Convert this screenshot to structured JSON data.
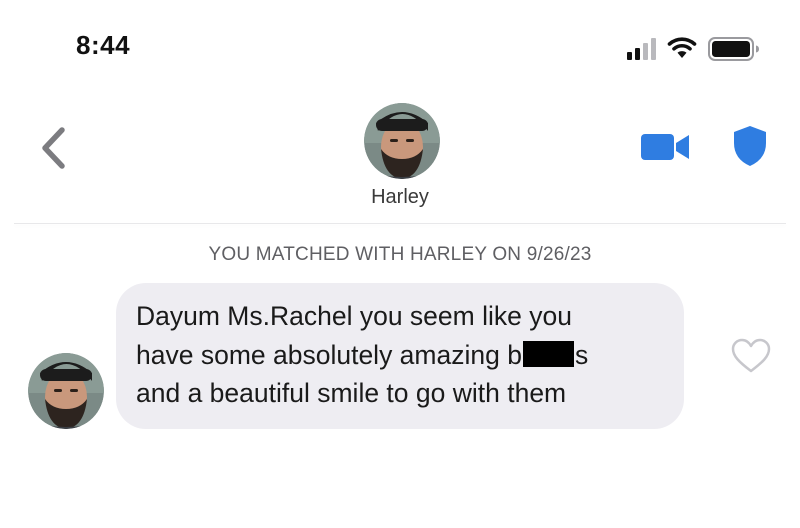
{
  "status_bar": {
    "time": "8:44"
  },
  "header": {
    "contact_name": "Harley"
  },
  "conversation": {
    "match_notice": "YOU MATCHED WITH HARLEY ON 9/26/23",
    "message": {
      "line1": "Dayum Ms.Rachel you seem like you",
      "line2_start": "have some absolutely amazing b",
      "line2_end": "s",
      "line3": "and a beautiful smile to go with them"
    }
  },
  "colors": {
    "accent_blue": "#2f7de1",
    "bubble_bg": "#eeedf2",
    "icon_gray": "#7c7c80",
    "redaction": "#000000"
  },
  "icons": {
    "back": "chevron-left-icon",
    "video": "video-camera-icon",
    "safety": "shield-icon",
    "like": "heart-outline-icon"
  }
}
